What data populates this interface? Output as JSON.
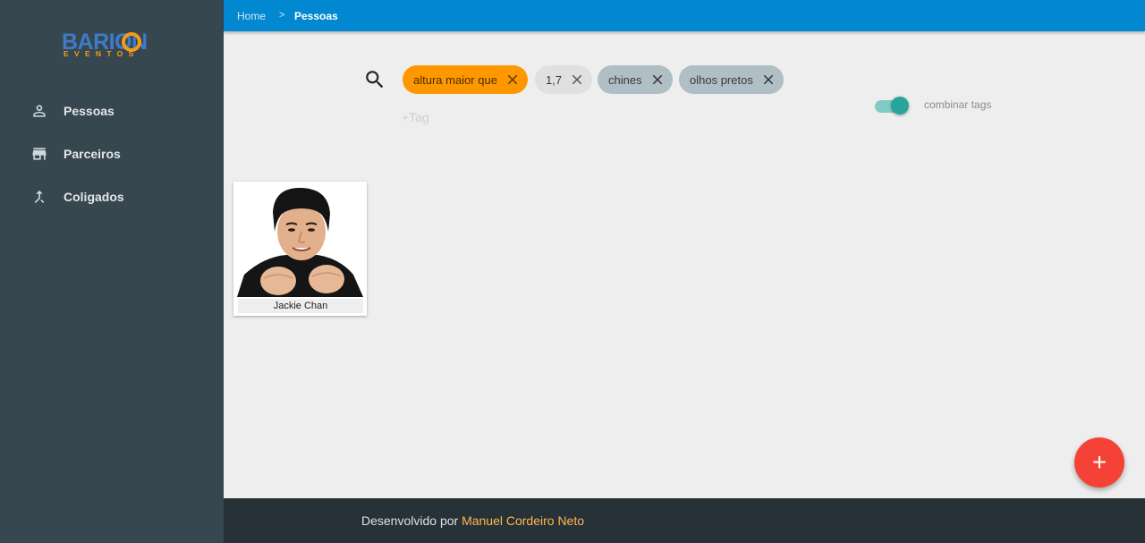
{
  "logo": {
    "main": "BARION",
    "sub": "EVENTOS"
  },
  "sidebar": {
    "items": [
      {
        "label": "Pessoas",
        "icon": "person-icon"
      },
      {
        "label": "Parceiros",
        "icon": "store-icon"
      },
      {
        "label": "Coligados",
        "icon": "merge-icon"
      }
    ]
  },
  "breadcrumb": {
    "home": "Home",
    "separator": ">",
    "current": "Pessoas"
  },
  "search": {
    "chips": [
      {
        "label": "altura maior que",
        "style": "orange"
      },
      {
        "label": "1,7",
        "style": "light"
      },
      {
        "label": "chines",
        "style": "grey"
      },
      {
        "label": "olhos pretos",
        "style": "grey"
      }
    ],
    "tag_placeholder": "+Tag"
  },
  "toggle": {
    "label": "combinar tags",
    "on": true
  },
  "cards": [
    {
      "name": "Jackie Chan"
    }
  ],
  "fab": {
    "label": "+"
  },
  "footer": {
    "prefix": "Desenvolvido por",
    "author": "Manuel Cordeiro Neto"
  },
  "colors": {
    "sidebar": "#37474f",
    "topbar": "#0288d1",
    "chip_orange": "#ff9800",
    "chip_grey": "#b0bec5",
    "toggle": "#26a69a",
    "fab": "#f44336",
    "footer": "#263238",
    "footer_author": "#ffb74d"
  }
}
